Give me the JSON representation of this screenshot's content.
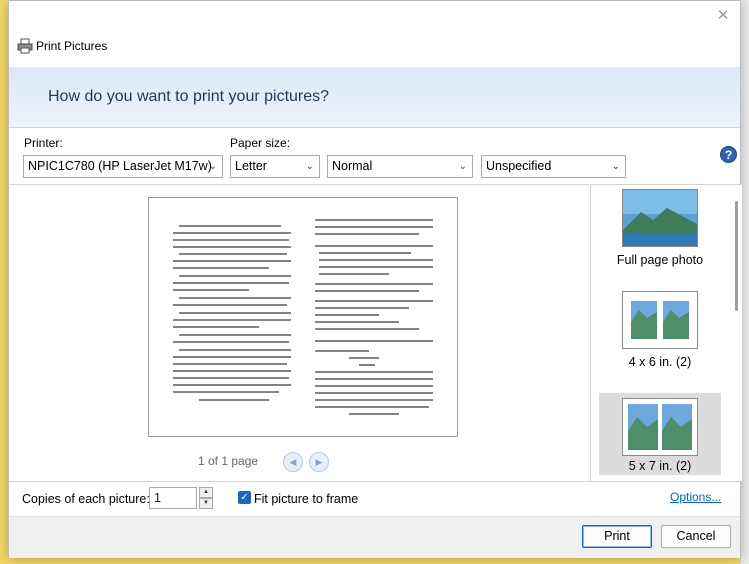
{
  "window": {
    "title": "Print Pictures",
    "close_glyph": "✕"
  },
  "header": {
    "question": "How do you want to print your pictures?"
  },
  "settings": {
    "printer_label": "Printer:",
    "printer_value": "NPIC1C780 (HP LaserJet M17w)",
    "paper_size_label": "Paper size:",
    "paper_size_value": "Letter",
    "quality_value": "Normal",
    "paper_type_value": "Unspecified",
    "help_glyph": "?"
  },
  "preview": {
    "page_indicator": "1 of 1 page",
    "prev_glyph": "◀",
    "next_glyph": "▶"
  },
  "layouts": {
    "items": [
      {
        "label": "Full page photo",
        "selected": false
      },
      {
        "label": "4 x 6 in. (2)",
        "selected": false
      },
      {
        "label": "5 x 7 in. (2)",
        "selected": true
      }
    ]
  },
  "options": {
    "copies_label": "Copies of each picture:",
    "copies_value": "1",
    "fit_label": "Fit picture to frame",
    "fit_checked": true,
    "options_link": "Options..."
  },
  "footer": {
    "print_label": "Print",
    "cancel_label": "Cancel"
  },
  "colors": {
    "accent": "#0067c0",
    "header_text": "#1e395b",
    "desktop_bg": "#f2d765"
  }
}
